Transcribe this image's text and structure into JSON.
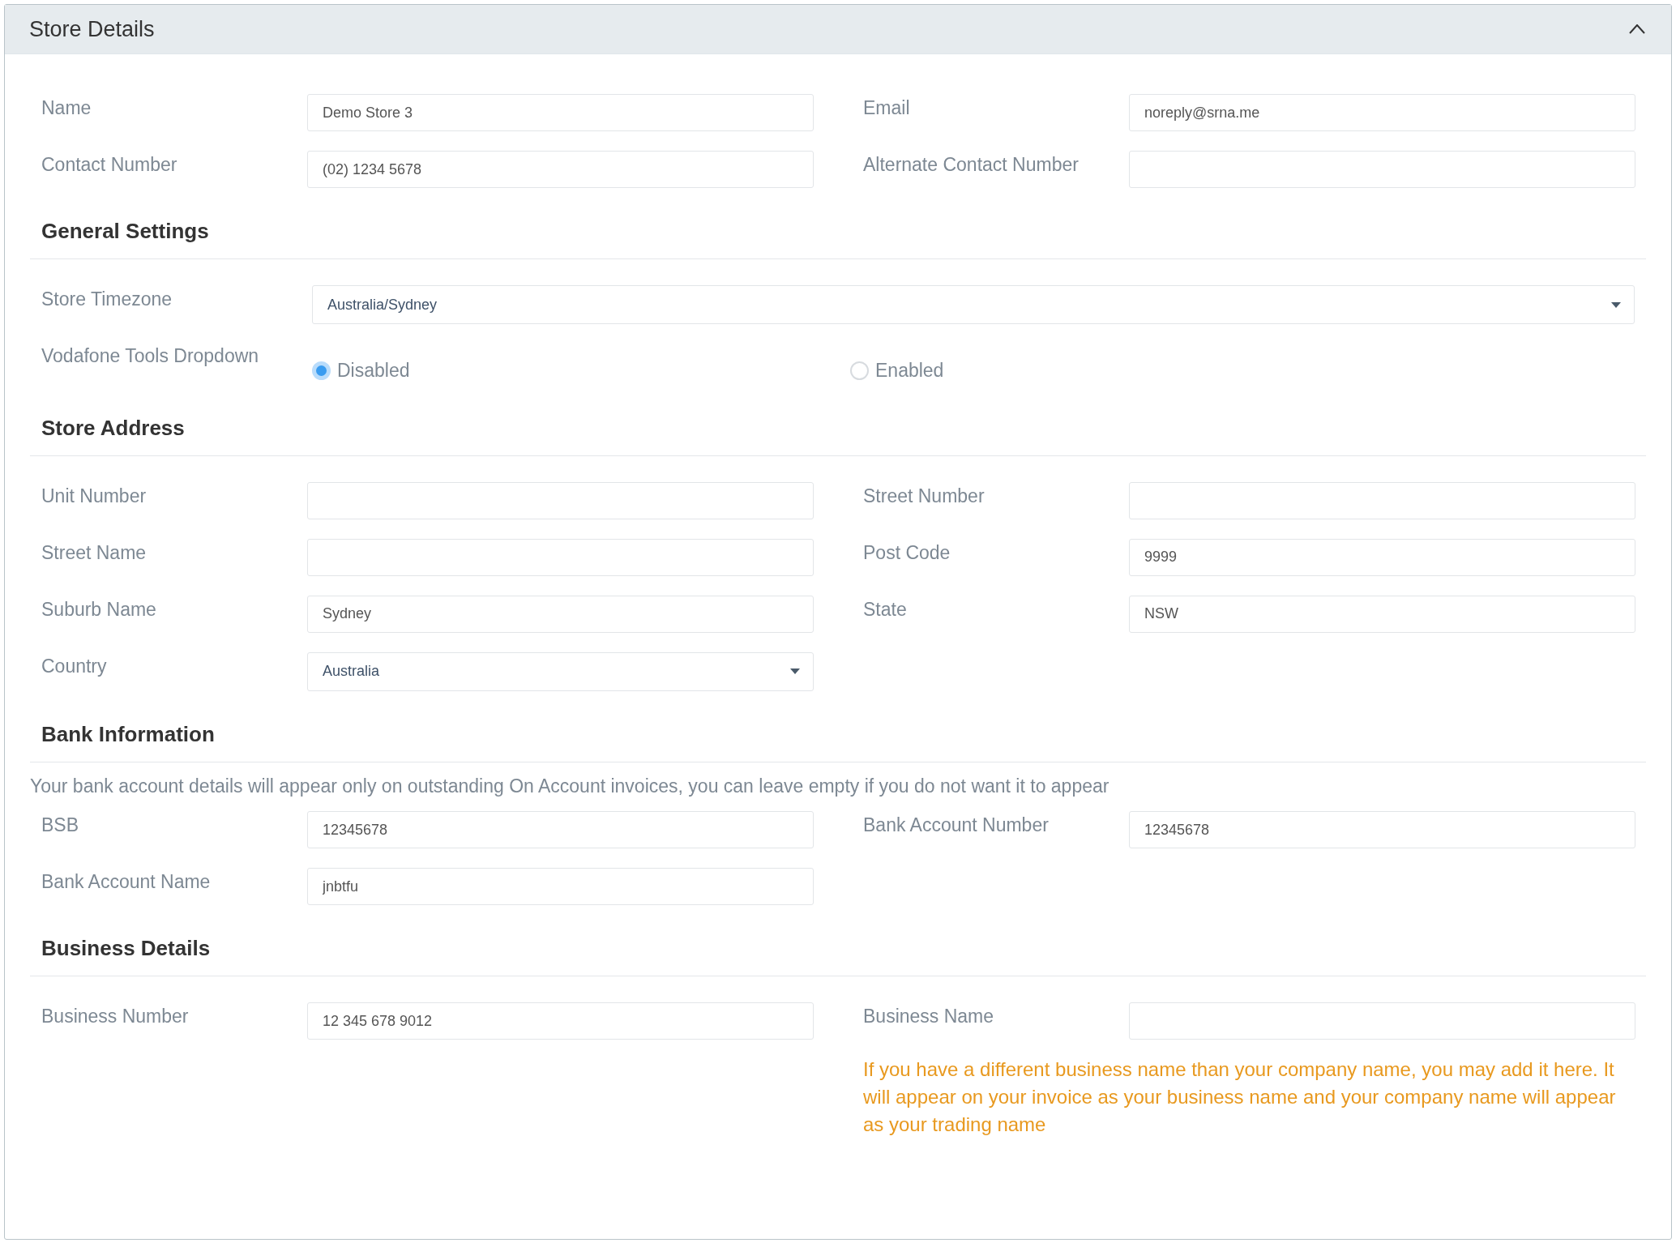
{
  "panel": {
    "title": "Store Details",
    "expanded": true
  },
  "sections": [
    {
      "kind": "pairs",
      "fields": [
        {
          "kind": "text",
          "label": "Name",
          "value": "Demo Store 3"
        },
        {
          "kind": "text",
          "label": "Email",
          "value": "noreply@srna.me"
        },
        {
          "kind": "text",
          "label": "Contact Number",
          "value": "(02) 1234 5678"
        },
        {
          "kind": "text",
          "label": "Alternate Contact Number"
        }
      ]
    },
    {
      "heading": "General Settings",
      "kind": "rows",
      "fields": [
        {
          "kind": "select",
          "label": "Store Timezone",
          "value": "Australia/Sydney"
        },
        {
          "kind": "radio",
          "label": "Vodafone Tools Dropdown",
          "options": [
            {
              "label": "Disabled",
              "selected": true
            },
            {
              "label": "Enabled",
              "selected": false
            }
          ]
        }
      ]
    },
    {
      "heading": "Store Address",
      "kind": "pairs",
      "fields": [
        {
          "kind": "text",
          "label": "Unit Number"
        },
        {
          "kind": "text",
          "label": "Street Number"
        },
        {
          "kind": "text",
          "label": "Street Name"
        },
        {
          "kind": "text",
          "label": "Post Code",
          "value": "9999"
        },
        {
          "kind": "text",
          "label": "Suburb Name",
          "value": "Sydney"
        },
        {
          "kind": "text",
          "label": "State",
          "value": "NSW"
        },
        {
          "kind": "select",
          "label": "Country",
          "value": "Australia"
        }
      ]
    },
    {
      "heading": "Bank Information",
      "note": "Your bank account details will appear only on outstanding On Account invoices, you can leave empty if you do not want it to appear",
      "kind": "pairs",
      "fields": [
        {
          "kind": "text",
          "label": "BSB",
          "value": "12345678"
        },
        {
          "kind": "text",
          "label": "Bank Account Number",
          "value": "12345678"
        },
        {
          "kind": "text",
          "label": "Bank Account Name",
          "value": "jnbtfu"
        }
      ]
    },
    {
      "heading": "Business Details",
      "kind": "pairs",
      "fields": [
        {
          "kind": "text",
          "label": "Business Number",
          "value": "12 345 678 9012"
        },
        {
          "kind": "text",
          "label": "Business Name",
          "hint": "If you have a different business name than your company name, you may add it here. It will appear on your invoice as your business name and your company name will appear as your trading name"
        }
      ]
    }
  ]
}
